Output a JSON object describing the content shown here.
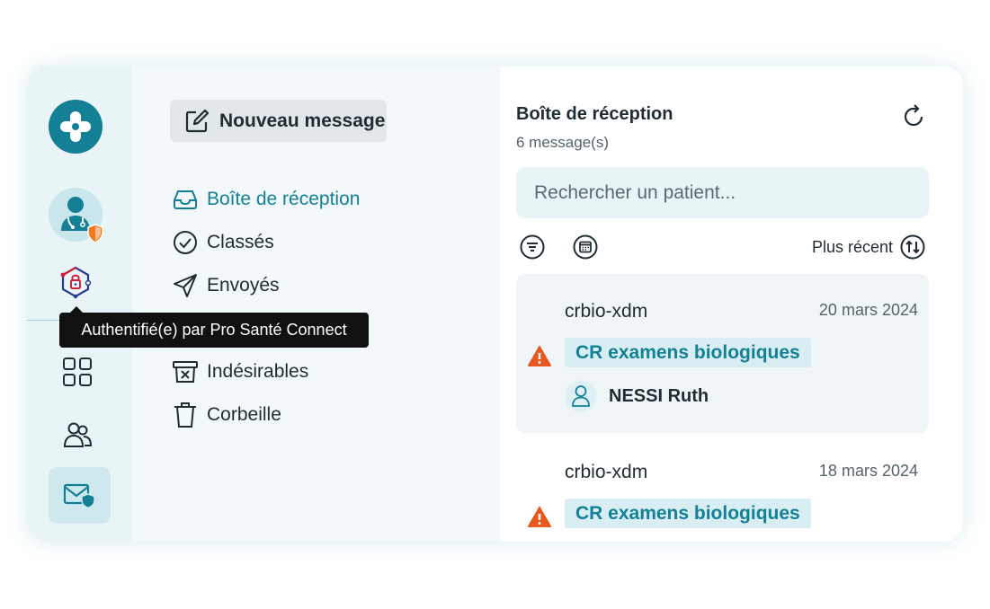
{
  "colors": {
    "accent": "#138096",
    "rail_bg": "#e9f4f7",
    "warning": "#e8581f"
  },
  "rail": {
    "items": [
      {
        "icon": "medical-cross-logo-icon"
      },
      {
        "icon": "doctor-avatar-icon"
      },
      {
        "icon": "pro-sante-connect-icon"
      },
      {
        "icon": "apps-grid-icon"
      },
      {
        "icon": "users-icon"
      },
      {
        "icon": "secure-mail-icon"
      }
    ]
  },
  "tooltip": {
    "text": "Authentifié(e) par Pro Santé Connect"
  },
  "toolbar": {
    "new_message_label": "Nouveau message"
  },
  "folders": [
    {
      "label": "Boîte de réception",
      "icon": "inbox-icon",
      "active": true
    },
    {
      "label": "Classés",
      "icon": "check-circle-icon"
    },
    {
      "label": "Envoyés",
      "icon": "send-icon"
    },
    {
      "label": "",
      "icon": "draft-icon"
    },
    {
      "label": "Indésirables",
      "icon": "spam-icon"
    },
    {
      "label": "Corbeille",
      "icon": "trash-icon"
    }
  ],
  "list": {
    "title": "Boîte de réception",
    "count": "6 message(s)",
    "search_placeholder": "Rechercher un patient...",
    "sort_label": "Plus récent",
    "messages": [
      {
        "sender": "crbio-xdm",
        "date": "20 mars 2024",
        "tag": "CR examens biologiques",
        "patient": "NESSI Ruth",
        "selected": true
      },
      {
        "sender": "crbio-xdm",
        "date": "18 mars 2024",
        "tag": "CR examens biologiques",
        "patient": ""
      }
    ]
  }
}
